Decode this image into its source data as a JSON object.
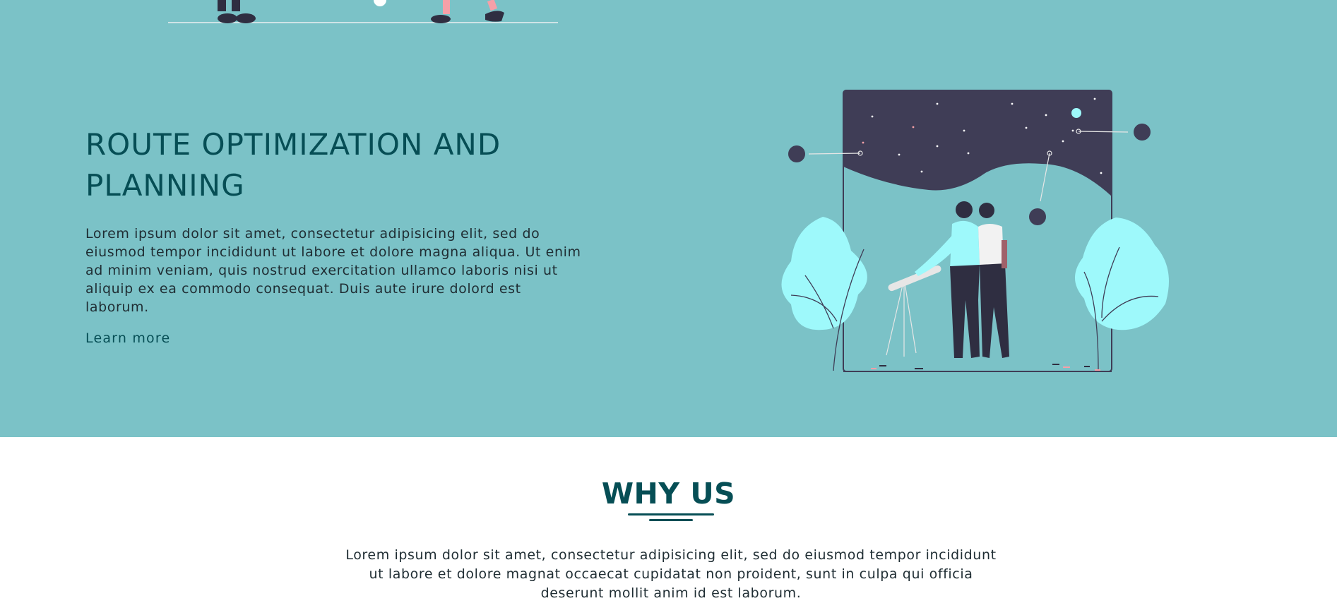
{
  "feature": {
    "title": "ROUTE OPTIMIZATION AND PLANNING",
    "body": "Lorem ipsum dolor sit amet, consectetur adipisicing elit, sed do eiusmod tempor incididunt ut labore et dolore magna aliqua. Ut enim ad minim veniam, quis nostrud exercitation ullamco laboris nisi ut aliquip ex ea commodo consequat. Duis aute irure dolord est laborum.",
    "link_label": "Learn more",
    "illustration": "stargazing-illustration"
  },
  "why_us": {
    "title": "WHY US",
    "body": "Lorem ipsum dolor sit amet, consectetur adipisicing elit, sed do eiusmod tempor incididunt ut labore et dolore magnat occaecat cupidatat non proident, sunt in culpa qui officia deserunt mollit anim id est laborum."
  },
  "colors": {
    "band": "#7bc2c7",
    "heading": "#064e55",
    "text": "#1f2d33",
    "accent_cyan": "#9ef9fb",
    "night_sky": "#3f3d56"
  }
}
